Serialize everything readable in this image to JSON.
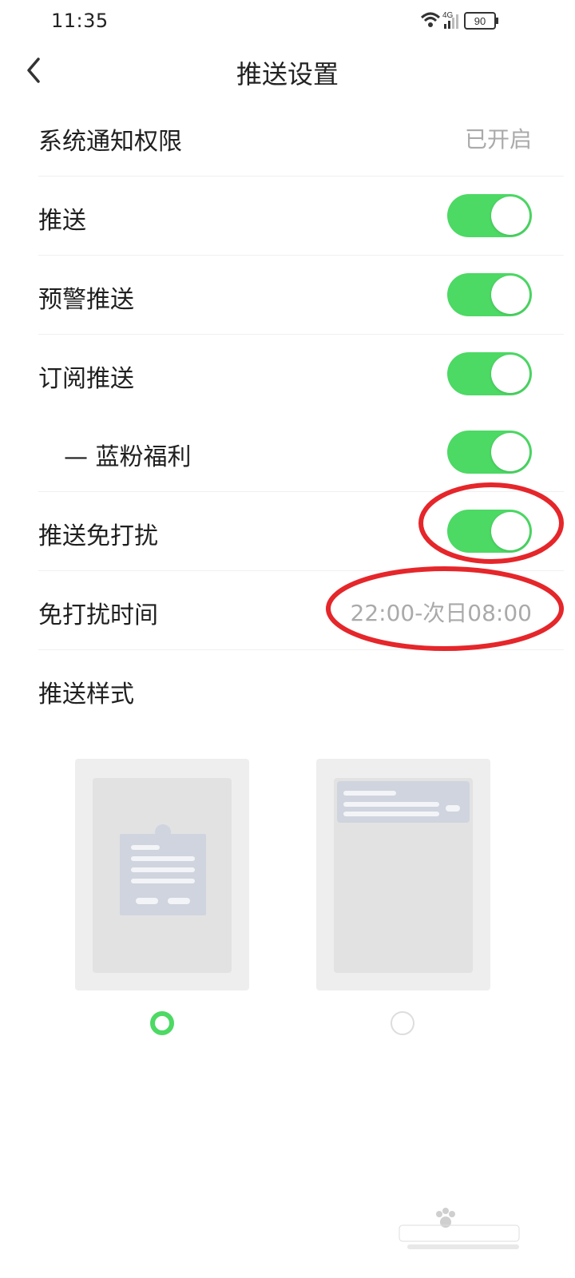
{
  "status_bar": {
    "time": "11:35",
    "network": "4G",
    "battery": "90",
    "icons": [
      "wifi-icon",
      "signal-icon",
      "battery-icon"
    ]
  },
  "header": {
    "title": "推送设置",
    "back_icon": "chevron-left-icon"
  },
  "settings": {
    "system_permission": {
      "label": "系统通知权限",
      "value": "已开启"
    },
    "push": {
      "label": "推送",
      "enabled": true
    },
    "alert_push": {
      "label": "预警推送",
      "enabled": true
    },
    "subscription_push": {
      "label": "订阅推送",
      "enabled": true
    },
    "blue_fan_welfare": {
      "label": "—  蓝粉福利",
      "enabled": true
    },
    "dnd": {
      "label": "推送免打扰",
      "enabled": true
    },
    "dnd_time": {
      "label": "免打扰时间",
      "value": "22:00-次日08:00"
    },
    "push_style": {
      "label": "推送样式"
    }
  },
  "push_style_options": [
    {
      "id": "popup",
      "selected": true
    },
    {
      "id": "banner",
      "selected": false
    }
  ],
  "colors": {
    "toggle_on": "#4cd964",
    "annotation": "#e5262a",
    "muted_text": "#aaaaaa"
  }
}
